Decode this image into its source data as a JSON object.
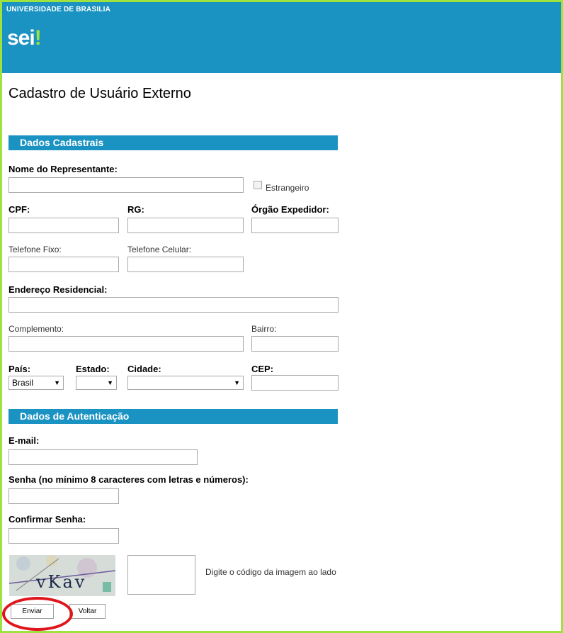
{
  "header": {
    "university": "UNIVERSIDADE DE BRASILIA",
    "logo_text": "sei",
    "logo_dot": "!"
  },
  "page": {
    "title": "Cadastro de Usuário Externo"
  },
  "sections": {
    "dados_cadastrais": "Dados Cadastrais",
    "dados_autenticacao": "Dados de Autenticação"
  },
  "fields": {
    "nome_representante": {
      "label": "Nome do Representante:",
      "value": ""
    },
    "estrangeiro": {
      "label": "Estrangeiro",
      "checked": false
    },
    "cpf": {
      "label": "CPF:",
      "value": ""
    },
    "rg": {
      "label": "RG:",
      "value": ""
    },
    "orgao_expedidor": {
      "label": "Órgão Expedidor:",
      "value": ""
    },
    "telefone_fixo": {
      "label": "Telefone Fixo:",
      "value": ""
    },
    "telefone_celular": {
      "label": "Telefone Celular:",
      "value": ""
    },
    "endereco": {
      "label": "Endereço Residencial:",
      "value": ""
    },
    "complemento": {
      "label": "Complemento:",
      "value": ""
    },
    "bairro": {
      "label": "Bairro:",
      "value": ""
    },
    "pais": {
      "label": "País:",
      "value": "Brasil"
    },
    "estado": {
      "label": "Estado:",
      "value": ""
    },
    "cidade": {
      "label": "Cidade:",
      "value": ""
    },
    "cep": {
      "label": "CEP:",
      "value": ""
    },
    "email": {
      "label": "E-mail:",
      "value": ""
    },
    "senha": {
      "label": "Senha (no mínimo 8 caracteres com letras e números):",
      "value": ""
    },
    "confirmar_senha": {
      "label": "Confirmar Senha:",
      "value": ""
    },
    "captcha": {
      "image_text": "vKav",
      "hint": "Digite o código da imagem ao lado",
      "value": ""
    }
  },
  "buttons": {
    "enviar": "Enviar",
    "voltar": "Voltar"
  },
  "colors": {
    "brand_blue": "#1a93c2",
    "frame_green": "#9ee33d",
    "highlight_red": "#e0141b"
  },
  "icons": {
    "dropdown": "chevron-down-icon"
  }
}
